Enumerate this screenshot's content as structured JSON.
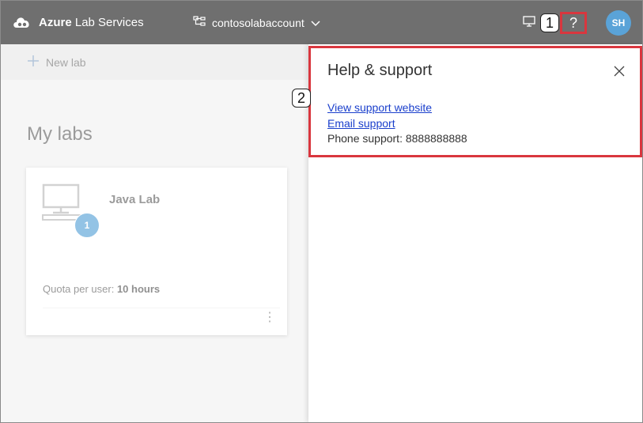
{
  "app": {
    "brand_bold": "Azure",
    "brand_rest": " Lab Services",
    "account_name": "contosolabaccount",
    "help_glyph": "?",
    "user_initials": "SH"
  },
  "callouts": {
    "one": "1",
    "two": "2"
  },
  "commandbar": {
    "new_lab_label": "New lab"
  },
  "page": {
    "title": "My labs"
  },
  "lab_card": {
    "name": "Java Lab",
    "vm_count": "1",
    "quota_label": "Quota per user: ",
    "quota_value": "10 hours",
    "more_glyph": "⋮"
  },
  "help_panel": {
    "title": "Help & support",
    "website_link": "View support website",
    "email_link": "Email support",
    "phone_text": "Phone support: 8888888888"
  },
  "icons": {
    "brand": "azure-lab-services-logo",
    "account": "lab-account-icon",
    "monitor": "monitor-icon",
    "close": "close-icon",
    "vm": "virtual-machine-icon"
  },
  "colors": {
    "topbar": "#6f6f6f",
    "accent_blue": "#5aa3d8",
    "highlight_red": "#d9363e",
    "link": "#1a3fcc"
  }
}
